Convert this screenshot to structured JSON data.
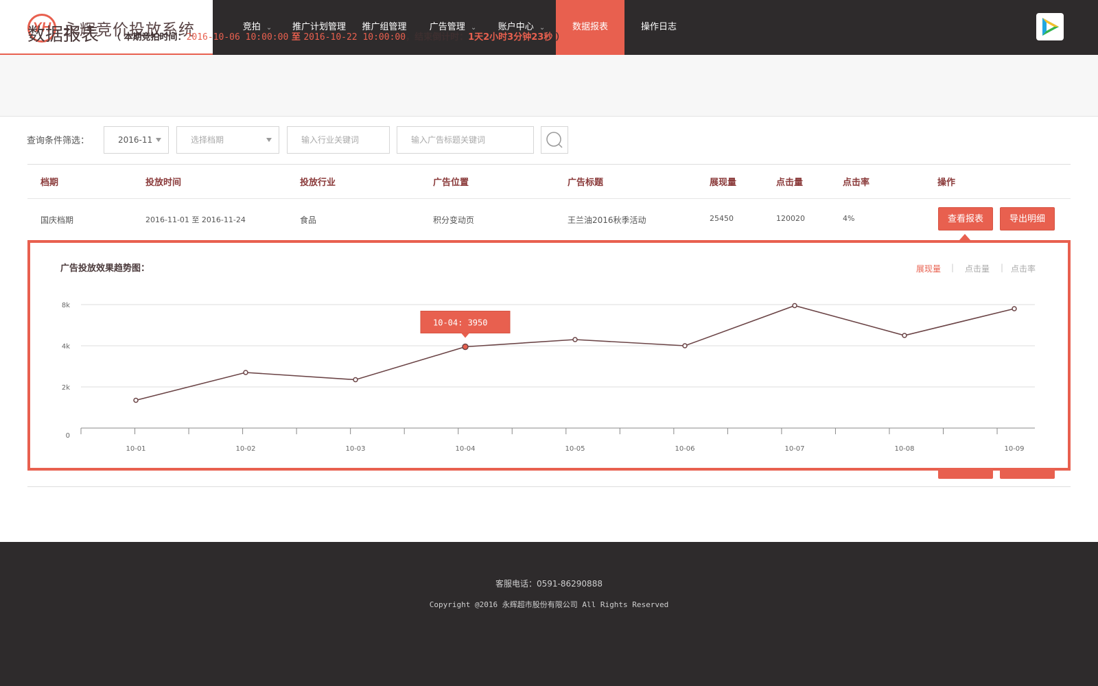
{
  "brand": {
    "logo_mark": "YH",
    "name": "永辉竞价投放系统"
  },
  "nav": [
    {
      "label": "竞拍",
      "dropdown": true
    },
    {
      "label": "推广计划管理",
      "dropdown": false
    },
    {
      "label": "推广组管理",
      "dropdown": false
    },
    {
      "label": "广告管理",
      "dropdown": true
    },
    {
      "label": "账户中心",
      "dropdown": true
    },
    {
      "label": "数据报表",
      "dropdown": false,
      "active": true
    },
    {
      "label": "操作日志",
      "dropdown": false
    }
  ],
  "page": {
    "title": "数据报表",
    "period_open": "（",
    "period_label": "本期竞拍时间：",
    "period_start": "2016-10-06 10:00:00",
    "period_to": "至",
    "period_end": "2016-10-22 10:00:00",
    "countdown_label": "，结束倒计时：",
    "countdown": "1天2小时3分钟23秒",
    "period_close": "）"
  },
  "filters": {
    "label": "查询条件筛选：",
    "month": "2016-11",
    "period_placeholder": "选择档期",
    "industry_placeholder": "输入行业关键词",
    "title_placeholder": "输入广告标题关键词"
  },
  "table": {
    "headers": [
      "档期",
      "投放时间",
      "投放行业",
      "广告位置",
      "广告标题",
      "展现量",
      "点击量",
      "点击率",
      "操作"
    ],
    "rows": [
      {
        "period": "国庆档期",
        "time": "2016-11-01 至 2016-11-24",
        "industry": "食品",
        "position": "积分变动页",
        "title": "王兰油2016秋季活动",
        "impressions": "25450",
        "clicks": "120020",
        "ctr": "4%"
      }
    ],
    "view_report": "查看报表",
    "export_detail": "导出明细"
  },
  "chart_panel": {
    "title": "广告投放效果趋势图：",
    "tabs": [
      "展现量",
      "点击量",
      "点击率"
    ],
    "active_tab": "展现量"
  },
  "chart_data": {
    "type": "line",
    "x": [
      "10-01",
      "10-02",
      "10-03",
      "10-04",
      "10-05",
      "10-06",
      "10-07",
      "10-08",
      "10-09"
    ],
    "values": [
      1350,
      2700,
      2350,
      3950,
      4600,
      4000,
      7900,
      5000,
      7600
    ],
    "y_ticks": [
      0,
      2000,
      4000,
      8000
    ],
    "y_tick_labels": [
      "0",
      "2k",
      "4k",
      "8k"
    ],
    "highlight_index": 3,
    "tooltip": "10-04: 3950",
    "line_color": "#6b4446",
    "highlight_color": "#e8604f",
    "grid": true
  },
  "footer": {
    "phone": "客服电话：0591-86290888",
    "copyright": "Copyright @2016 永辉超市股份有限公司  All Rights Reserved"
  },
  "colors": {
    "accent": "#e8604f",
    "dark": "#2e2b2c"
  }
}
